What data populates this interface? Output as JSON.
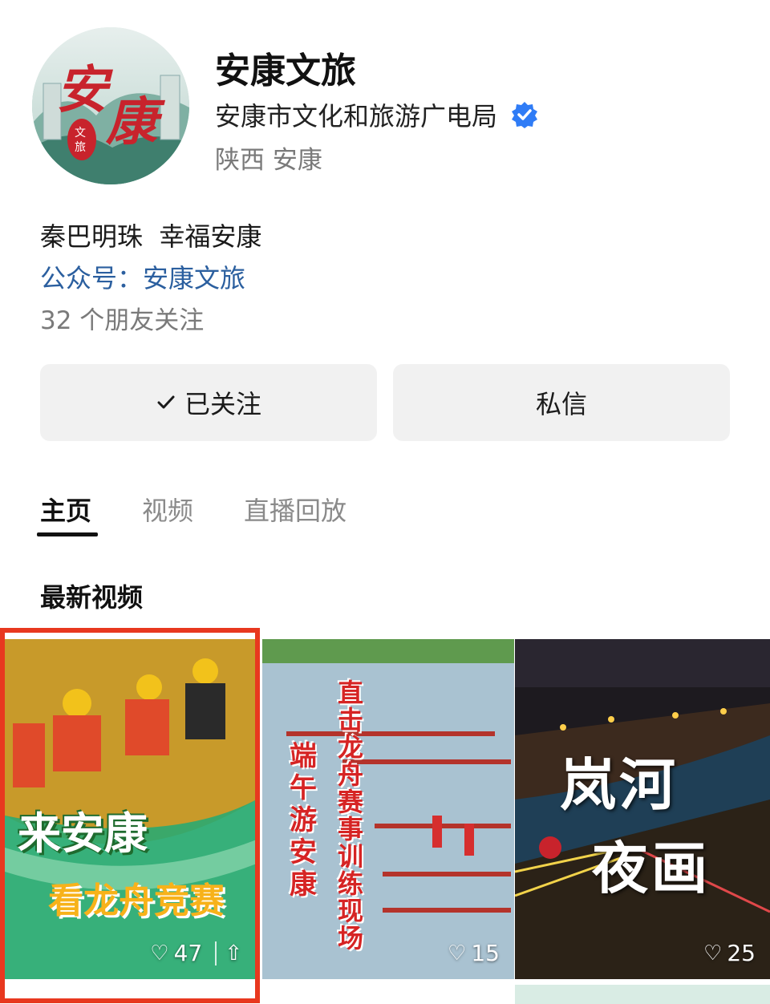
{
  "profile": {
    "name": "安康文旅",
    "org": "安康市文化和旅游广电局",
    "location": "陕西 安康",
    "slogan": "秦巴明珠  幸福安康",
    "official_account": "公众号：安康文旅",
    "friends": "32 个朋友关注",
    "avatar_logo": "安康",
    "avatar_badge": "文旅"
  },
  "buttons": {
    "follow_label": "已关注",
    "message_label": "私信"
  },
  "tabs": [
    {
      "label": "主页",
      "active": true
    },
    {
      "label": "视频",
      "active": false
    },
    {
      "label": "直播回放",
      "active": false
    }
  ],
  "section": {
    "title": "最新视频"
  },
  "videos": [
    {
      "title_line1": "来安康",
      "title_line2": "看龙舟竞赛",
      "likes": "47"
    },
    {
      "title_left": "端午游安康",
      "title_right": "直击龙舟赛事训练现场",
      "likes": "15"
    },
    {
      "title_line1": "岚河",
      "title_line2": "夜画",
      "likes": "25"
    }
  ],
  "colors": {
    "accent_blue": "#2b5f9f",
    "verified": "#2f7cf6",
    "highlight_border": "#e8381f"
  },
  "icons": {
    "verified": "verified-badge-icon",
    "check": "check-icon",
    "heart": "heart-icon",
    "share": "share-icon"
  }
}
